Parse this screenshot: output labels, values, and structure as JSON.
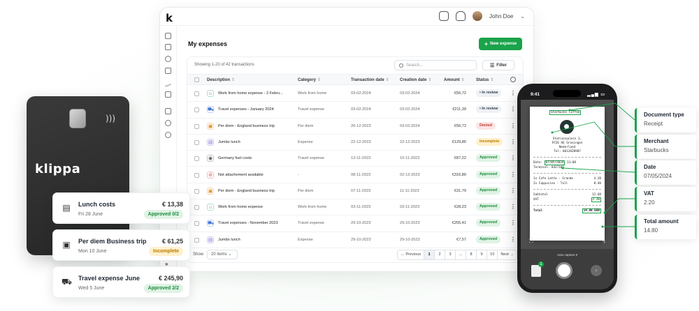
{
  "dashboard": {
    "logo": "k",
    "user_name": "John Doe",
    "page_title": "My expenses",
    "new_button": "New expense",
    "showing": "Showing 1-20 of 42 transactions",
    "search_placeholder": "Search...",
    "filter_label": "Filter",
    "columns": [
      "Description",
      "Category",
      "Transaction date",
      "Creation date",
      "Amount",
      "Status"
    ],
    "rows": [
      {
        "icon": "house-icon",
        "icon_color": "#1aa34a",
        "description": "Work from home expense - 3 Febru...",
        "category": "Work from home",
        "transaction_date": "03-02-2024",
        "creation_date": "03-02-2024",
        "amount": "€56,72",
        "status": "• In review",
        "status_type": "review"
      },
      {
        "icon": "car-icon",
        "icon_color": "#3b6fd8",
        "description": "Travel expenses - January 2024",
        "category": "Travel expense",
        "transaction_date": "03-02-2024",
        "creation_date": "03-02-2024",
        "amount": "€211,39",
        "status": "• In review",
        "status_type": "review"
      },
      {
        "icon": "briefcase-icon",
        "icon_color": "#e08a16",
        "description": "Per diem - England business trip",
        "category": "Per diem",
        "transaction_date": "26-12-2023",
        "creation_date": "03-02-2024",
        "amount": "€56,72",
        "status": "Denied",
        "status_type": "denied"
      },
      {
        "icon": "receipt-icon",
        "icon_color": "#7b5cd6",
        "description": "Jumbo lunch",
        "category": "Expense",
        "transaction_date": "22-12-2023",
        "creation_date": "22-12-2023",
        "amount": "€129,85",
        "status": "Incomplete",
        "status_type": "incomplete"
      },
      {
        "icon": "pin-icon",
        "icon_color": "#555555",
        "description": "Germany fuel costs",
        "category": "Travel expense",
        "transaction_date": "13-11-2023",
        "creation_date": "15-11-2023",
        "amount": "€87,22",
        "status": "Approved",
        "status_type": "approved"
      },
      {
        "icon": "no-entry-icon",
        "icon_color": "#d94040",
        "description": "Not attachement available",
        "category": "-",
        "transaction_date": "08-11-2023",
        "creation_date": "02-12-2023",
        "amount": "€316,80",
        "status": "Approved",
        "status_type": "approved"
      },
      {
        "icon": "briefcase-icon",
        "icon_color": "#e08a16",
        "description": "Per diem - England business trip",
        "category": "Per diem",
        "transaction_date": "07-11-2023",
        "creation_date": "11-11-2023",
        "amount": "€31,79",
        "status": "Approved",
        "status_type": "approved"
      },
      {
        "icon": "house-icon",
        "icon_color": "#1aa34a",
        "description": "Work from home expense",
        "category": "Work from home",
        "transaction_date": "03-11-2023",
        "creation_date": "03-11-2023",
        "amount": "€28,23",
        "status": "Approved",
        "status_type": "approved"
      },
      {
        "icon": "car-icon",
        "icon_color": "#3b6fd8",
        "description": "Travel expenses - November 2023",
        "category": "Travel expense",
        "transaction_date": "29-10-2023",
        "creation_date": "29-10-2023",
        "amount": "€255,41",
        "status": "Approved",
        "status_type": "approved"
      },
      {
        "icon": "receipt-icon",
        "icon_color": "#7b5cd6",
        "description": "Jumbo lunch",
        "category": "Expense",
        "transaction_date": "29-10-2023",
        "creation_date": "29-10-2023",
        "amount": "€7,57",
        "status": "Approved",
        "status_type": "approved"
      }
    ],
    "show_label": "Show",
    "per_page": "20 items",
    "pagination": [
      "← Previous",
      "1",
      "2",
      "3",
      "...",
      "8",
      "9",
      "10",
      "Next →"
    ],
    "active_page": "1"
  },
  "card": {
    "brand": "klippa"
  },
  "tiles": [
    {
      "icon": "receipt-icon",
      "title": "Lunch costs",
      "date": "Fri 28 June",
      "amount": "€ 13,38",
      "badge": "Approved 0/2",
      "badge_type": "approved"
    },
    {
      "icon": "briefcase-icon",
      "title": "Per diem Business trip",
      "date": "Mon 10 June",
      "amount": "€ 61,25",
      "badge": "Incomplete",
      "badge_type": "incomplete"
    },
    {
      "icon": "car-icon",
      "title": "Travel expense June",
      "date": "Wed 5 June",
      "amount": "€ 245,90",
      "badge": "Approved 2/2",
      "badge_type": "approved"
    }
  ],
  "phone": {
    "time": "9:41",
    "receipt": {
      "merchant_tag": "Starbucks Coffee",
      "address": [
        "Stationsplein 3,",
        "9726 AE Groningen",
        "Nederland",
        "Tel: 0612028907"
      ],
      "date_label": "Date:",
      "date_value": "07/05/2024",
      "time_value": "13:08",
      "terminal": "Terminal: 0427105",
      "items": [
        {
          "name": "1x Cafe Latte - Grande",
          "price": "4.20"
        },
        {
          "name": "2x Cappucino - Tall",
          "price": "8.40"
        }
      ],
      "subtotal_label": "Subtotal",
      "subtotal": "12.60",
      "vat_label": "VAT",
      "vat": "2.20",
      "total_label": "Total",
      "total": "14,80 EUR"
    },
    "camera_mode": "Auto capture ▾",
    "thumb_count": "1"
  },
  "extraction": [
    {
      "title": "Document type",
      "value": "Receipt"
    },
    {
      "title": "Merchant",
      "value": "Starbucks"
    },
    {
      "title": "Date",
      "value": "07/05/2024"
    },
    {
      "title": "VAT",
      "value": "2.20"
    },
    {
      "title": "Total amount",
      "value": "14.80"
    }
  ],
  "colors": {
    "accent": "#1aa34a",
    "approved_bg": "#dff3e4",
    "incomplete_bg": "#fff1cc",
    "denied_bg": "#fde4e4",
    "card_bg": "#2e2e2e"
  }
}
